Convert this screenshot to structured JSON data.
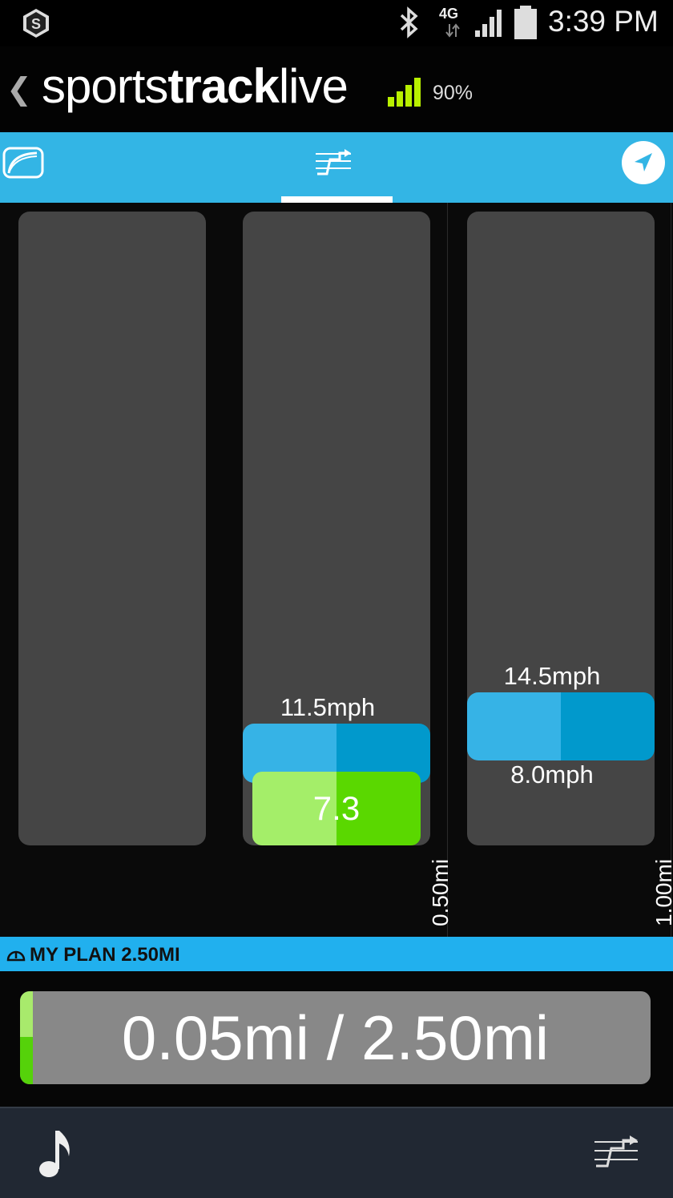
{
  "status_bar": {
    "time": "3:39 PM",
    "network": "4G",
    "icons": [
      "app-s-icon",
      "bluetooth-icon",
      "data-arrows-icon",
      "cell-signal-icon",
      "battery-icon"
    ]
  },
  "header": {
    "logo_part1": "sports",
    "logo_part2": "track",
    "logo_part3": "live",
    "signal_percent": "90%"
  },
  "tabs": {
    "items": [
      "speedometer-icon",
      "plan-chart-icon",
      "navigation-icon"
    ],
    "active_index": 1
  },
  "chart": {
    "columns": [
      {
        "segment": 1
      },
      {
        "segment": 2,
        "max_speed": "11.5mph",
        "current": "7.3",
        "distance_label": "0.50mi"
      },
      {
        "segment": 3,
        "max_speed": "14.5mph",
        "min_speed": "8.0mph",
        "distance_label": "1.00mi"
      }
    ]
  },
  "plan": {
    "title": "MY PLAN 2.50MI",
    "progress_text": "0.05mi / 2.50mi",
    "progress_fraction": 0.02
  },
  "bottom_bar": {
    "icons": [
      "music-note-icon",
      "plan-chart-icon"
    ]
  },
  "colors": {
    "accent_blue": "#33b5e5",
    "band_light": "#36b3e6",
    "band_dark": "#0199cc",
    "green_light": "#a4ee69",
    "green_dark": "#5ad800",
    "logo_green": "#b8f000"
  }
}
